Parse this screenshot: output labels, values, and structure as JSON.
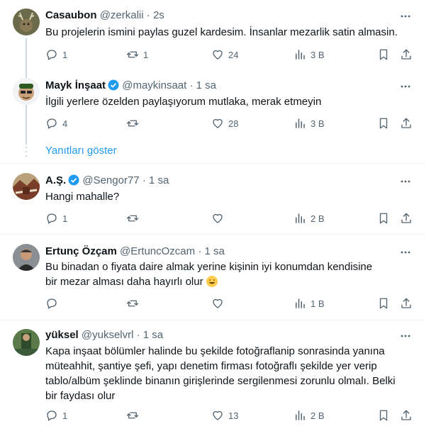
{
  "tweets": [
    {
      "name": "Casaubon",
      "handle": "@zerkalii",
      "time": "2s",
      "verified": false,
      "text": "Bu projelerin ismini paylas guzel kardesim. İnsanlar mezarlik satin almasin.",
      "replies": "1",
      "retweets": "1",
      "likes": "24",
      "views": "3 B"
    },
    {
      "name": "Mayk İnşaat",
      "handle": "@maykinsaat",
      "time": "1 sa",
      "verified": true,
      "text": "İlgili yerlere özelden paylaşıyorum mutlaka, merak etmeyin",
      "replies": "4",
      "retweets": "",
      "likes": "28",
      "views": "3 B"
    },
    {
      "name": "A.Ş.",
      "handle": "@Sengor77",
      "time": "1 sa",
      "verified": true,
      "text": "Hangi mahalle?",
      "replies": "1",
      "retweets": "",
      "likes": "",
      "views": "2 B"
    },
    {
      "name": "Ertunç Özçam",
      "handle": "@ErtuncOzcam",
      "time": "1 sa",
      "verified": false,
      "text": "Bu binadan o fiyata daire almak yerine kişinin iyi konumdan kendisine bir mezar alması daha hayırlı olur",
      "replies": "",
      "retweets": "",
      "likes": "",
      "views": "1 B"
    },
    {
      "name": "yüksel",
      "handle": "@yukselvrl",
      "time": "1 sa",
      "verified": false,
      "text": "Kapa inşaat bölümler halinde bu şekilde fotoğraflanip sonrasinda yanına müteahhit, şantiye şefi, yapı denetim  firması fotoğraflı şekilde yer verip tablo/albüm şeklinde binanın girişlerinde sergilenmesi zorunlu olmalı. Belki bir faydası olur",
      "replies": "1",
      "retweets": "",
      "likes": "13",
      "views": "2 B"
    }
  ],
  "show_replies_label": "Yanıtları göster",
  "dot": "·",
  "colors": {
    "accent": "#1d9bf0",
    "muted": "#536471",
    "text": "#0f1419",
    "divider": "#eff3f4"
  }
}
